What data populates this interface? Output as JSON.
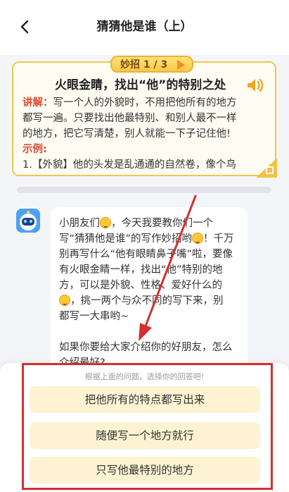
{
  "header": {
    "title": "猜猜他是谁（上）",
    "back_icon": "chevron-left-icon"
  },
  "tip": {
    "badge_label": "妙招 1 / 3",
    "heading": "火眼金睛，找出“他”的特别之处",
    "explain_label": "讲解",
    "explain_lines": [
      "：写一个人的外貌时，不用把他所有的地方",
      "都写一遍。只要找出他最特别、和别人最不一样",
      "的地方，把它写清楚，别人就能一下子记住他!"
    ],
    "example_label": "示例",
    "example_colon": ":",
    "example_line": "1.【外貌】他的头发是乱通通的自然卷，像个鸟",
    "sound_icon": "speaker-icon",
    "accent_color": "#f3c64b"
  },
  "chat": {
    "avatar_icon": "robot-avatar-icon",
    "lines": [
      {
        "pre": "小朋友们",
        "emoji": true,
        "post": "，今天我要教你们一个"
      },
      {
        "pre": "写“猜猜他是谁”的写作妙招哟",
        "emoji": true,
        "post": "！千万"
      },
      {
        "pre": "别再写什么“他有眼睛鼻子嘴”啦，要像",
        "emoji": false,
        "post": ""
      },
      {
        "pre": "有火眼金睛一样，找出“他”特别的地",
        "emoji": false,
        "post": ""
      },
      {
        "pre": "方，可以是外貌、性格、爱好什么的",
        "emoji": false,
        "post": ""
      },
      {
        "pre": "",
        "emoji": true,
        "post": "，挑一两个与众不同的写下来，别"
      },
      {
        "pre": "都写一大串哟~",
        "emoji": false,
        "post": ""
      },
      {
        "pre": "",
        "emoji": false,
        "post": ""
      },
      {
        "pre": "如果你要给大家介绍你的好朋友，怎么",
        "emoji": false,
        "post": ""
      },
      {
        "pre": "介绍最好?",
        "emoji": false,
        "post": ""
      }
    ]
  },
  "answers": {
    "prompt": "根据上面的问题，选择你的回答吧!",
    "options": [
      "把他所有的特点都写出来",
      "随便写一个地方就行",
      "只写他最特别的地方"
    ]
  },
  "annotation": {
    "color": "#d32f2f"
  }
}
